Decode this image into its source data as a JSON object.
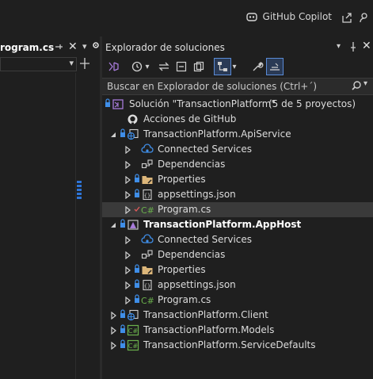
{
  "topbar": {
    "copilot_label": "GitHub Copilot"
  },
  "editor": {
    "tab_label": "rogram.cs"
  },
  "solution_explorer": {
    "title": "Explorador de soluciones",
    "search_placeholder": "Buscar en Explorador de soluciones (Ctrl+´)",
    "solution_label": "Solución \"TransactionPlatform\"",
    "solution_count": "(5 de 5 proyectos)",
    "items": [
      {
        "label": "Acciones de GitHub"
      },
      {
        "label": "TransactionPlatform.ApiService"
      },
      {
        "label": "Connected Services"
      },
      {
        "label": "Dependencias"
      },
      {
        "label": "Properties"
      },
      {
        "label": "appsettings.json"
      },
      {
        "label": "Program.cs"
      },
      {
        "label": "TransactionPlatform.AppHost"
      },
      {
        "label": "Connected Services"
      },
      {
        "label": "Dependencias"
      },
      {
        "label": "Properties"
      },
      {
        "label": "appsettings.json"
      },
      {
        "label": "Program.cs"
      },
      {
        "label": "TransactionPlatform.Client"
      },
      {
        "label": "TransactionPlatform.Models"
      },
      {
        "label": "TransactionPlatform.ServiceDefaults"
      }
    ]
  },
  "colors": {
    "accent_blue": "#3f8ee8",
    "green_csharp": "#6ab04c",
    "folder_yellow": "#dcb67a",
    "selected_row": "#3a3a3a"
  }
}
